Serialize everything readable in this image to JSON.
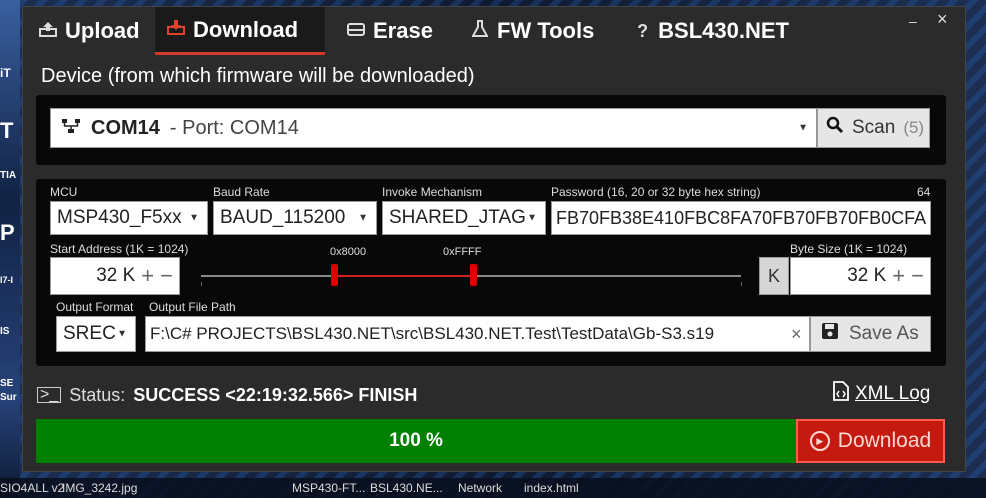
{
  "tabs": [
    {
      "label": "Upload",
      "icon": "upload-icon"
    },
    {
      "label": "Download",
      "icon": "download-icon"
    },
    {
      "label": "Erase",
      "icon": "eraser-icon"
    },
    {
      "label": "FW Tools",
      "icon": "flask-icon"
    },
    {
      "label": "BSL430.NET",
      "icon": "question-icon"
    }
  ],
  "active_tab": "Download",
  "window_controls": {
    "minimize": "–",
    "close": "×"
  },
  "device_section": {
    "title": "Device (from which firmware will be downloaded)",
    "device_name": "COM14",
    "device_port": "- Port: COM14",
    "scan_label": "Scan",
    "scan_count": "(5)"
  },
  "settings": {
    "mcu_label": "MCU",
    "mcu_value": "MSP430_F5xx",
    "baud_label": "Baud Rate",
    "baud_value": "BAUD_115200",
    "invoke_label": "Invoke Mechanism",
    "invoke_value": "SHARED_JTAG",
    "password_label": "Password (16, 20 or 32 byte hex string)",
    "password_length": "64",
    "password_value": "FB70FB38E410FBC8FA70FB70FB70FB0CFA",
    "start_label": "Start Address (1K = 1024)",
    "start_value": "32 K",
    "range_start_label": "0x8000",
    "range_end_label": "0xFFFF",
    "size_label": "Byte Size (1K = 1024)",
    "size_unit": "K",
    "size_value": "32 K",
    "plus": "+",
    "minus": "−",
    "output_format_label": "Output Format",
    "output_format_value": "SREC",
    "output_path_label": "Output File Path",
    "output_path_value": "F:\\C# PROJECTS\\BSL430.NET\\src\\BSL430.NET.Test\\TestData\\Gb-S3.s19",
    "clear": "×",
    "save_as_label": "Save As"
  },
  "status": {
    "label": "Status:",
    "value": "SUCCESS  <22:19:32.566>  FINISH",
    "xml_log_label": "XML Log"
  },
  "progress": {
    "value": 100,
    "text": "100 %"
  },
  "download_button_label": "Download",
  "colors": {
    "accent": "#d63a2a",
    "progress": "#008000",
    "download_button": "#c51a0f"
  },
  "taskbar": {
    "items": [
      "SIO4ALL v2",
      "IMG_3242.jpg",
      "MSP430-FT...",
      "BSL430.NE...",
      "Network",
      "index.html"
    ]
  },
  "desktop_left_letters": [
    "iT",
    "T",
    "TIA",
    "P",
    "I7-I",
    "IS",
    "SE",
    "Sur"
  ]
}
